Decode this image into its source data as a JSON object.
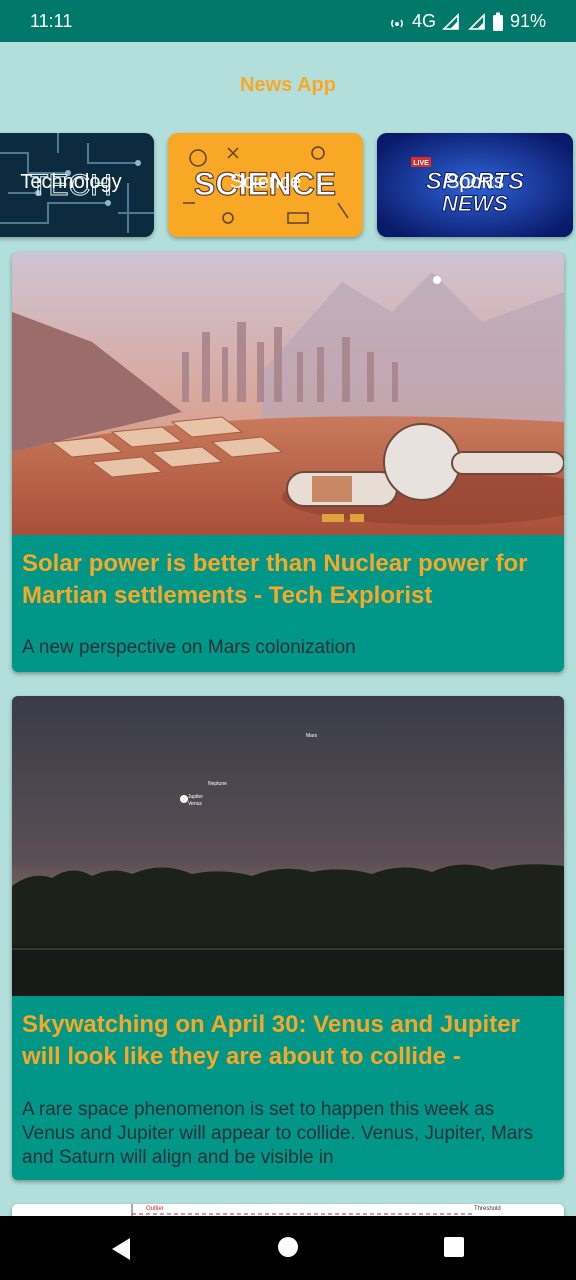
{
  "status": {
    "time": "11:11",
    "network": "4G",
    "battery": "91%"
  },
  "app": {
    "title": "News App"
  },
  "categories": [
    {
      "label": "Technology",
      "art": "TECH"
    },
    {
      "label": "Science",
      "art": "SCIENCE"
    },
    {
      "label": "Sports",
      "art_top": "SPORTS",
      "art_bottom": "NEWS",
      "badge": "LIVE"
    }
  ],
  "articles": [
    {
      "title": "Solar power is better than Nuclear power for Martian settlements - Tech Explorist",
      "description": "A new perspective on Mars colonization"
    },
    {
      "title": "Skywatching on April 30: Venus and Jupiter will look like they are about to collide -",
      "description": "A rare space phenomenon is set to happen this week as Venus and Jupiter will appear to collide. Venus, Jupiter, Mars and Saturn will align and be visible in",
      "image_labels": {
        "mars": "Mars",
        "neptune": "Neptune",
        "jupiter": "Jupiter",
        "venus": "Venus"
      }
    }
  ],
  "partial_card": {
    "label_1": "Outlier",
    "label_2": "Threshold"
  },
  "icons": {
    "back": "back-icon",
    "home": "home-icon",
    "recents": "recents-icon"
  },
  "colors": {
    "statusbar": "#00796b",
    "background": "#b2dfdb",
    "card": "#009688",
    "accent": "#f9a825"
  }
}
